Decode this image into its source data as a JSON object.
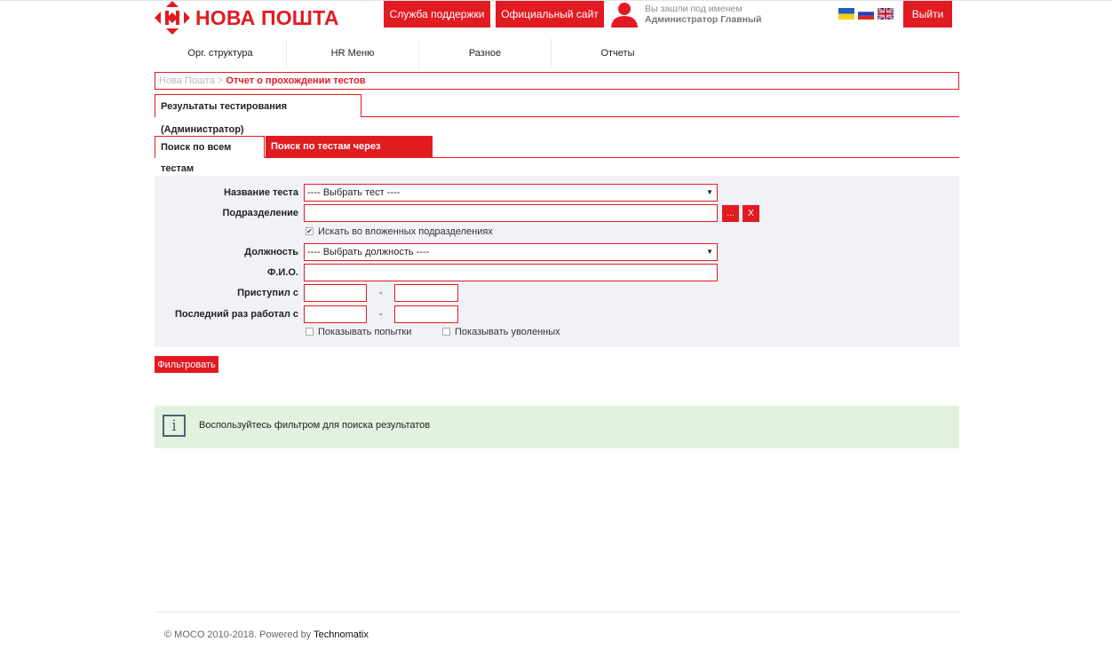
{
  "header": {
    "logo_text": "НОВА ПОШТА",
    "support_label": "Служба поддержки",
    "site_label": "Официальный сайт",
    "greeting": "Вы зашли под именем",
    "user_name": "Администратор Главный",
    "logout_label": "Выйти",
    "languages": [
      "Українська",
      "Русский",
      "English"
    ],
    "accent_color": "#e11b22"
  },
  "menu": {
    "items": [
      "Орг. структура",
      "HR Меню",
      "Разное",
      "Отчеты"
    ]
  },
  "breadcrumb": {
    "home": "Нова Пошта",
    "separator": ">",
    "current": "Отчет о прохождении тестов"
  },
  "section": {
    "title": "Результаты тестирования (Администратор)"
  },
  "tabs": [
    {
      "label": "Поиск по всем тестам",
      "active": false
    },
    {
      "label": "Поиск по тестам через программы",
      "active": true
    }
  ],
  "filters": {
    "test_name_label": "Название теста",
    "test_name_value": "---- Выбрать тест ----",
    "department_label": "Подразделение",
    "department_value": "",
    "browse_label": "...",
    "clear_label": "X",
    "nested_label": "Искать во вложенных подразделениях",
    "nested_checked": true,
    "position_label": "Должность",
    "position_value": "---- Выбрать должность ----",
    "fio_label": "Ф.И.О.",
    "fio_value": "",
    "started_label": "Приступил с",
    "last_worked_label": "Последний раз работал с",
    "range_separator": "-",
    "show_attempts_label": "Показывать попытки",
    "show_attempts_checked": false,
    "show_fired_label": "Показывать уволенных",
    "show_fired_checked": false,
    "caret": "▼"
  },
  "filter_button": "Фильтровать",
  "info": {
    "icon": "i",
    "message": "Воспользуйтесь фильтром для поиска результатов"
  },
  "footer": {
    "copyright": "© MOCO 2010-2018. Powered by ",
    "brand": "Technomatix"
  }
}
